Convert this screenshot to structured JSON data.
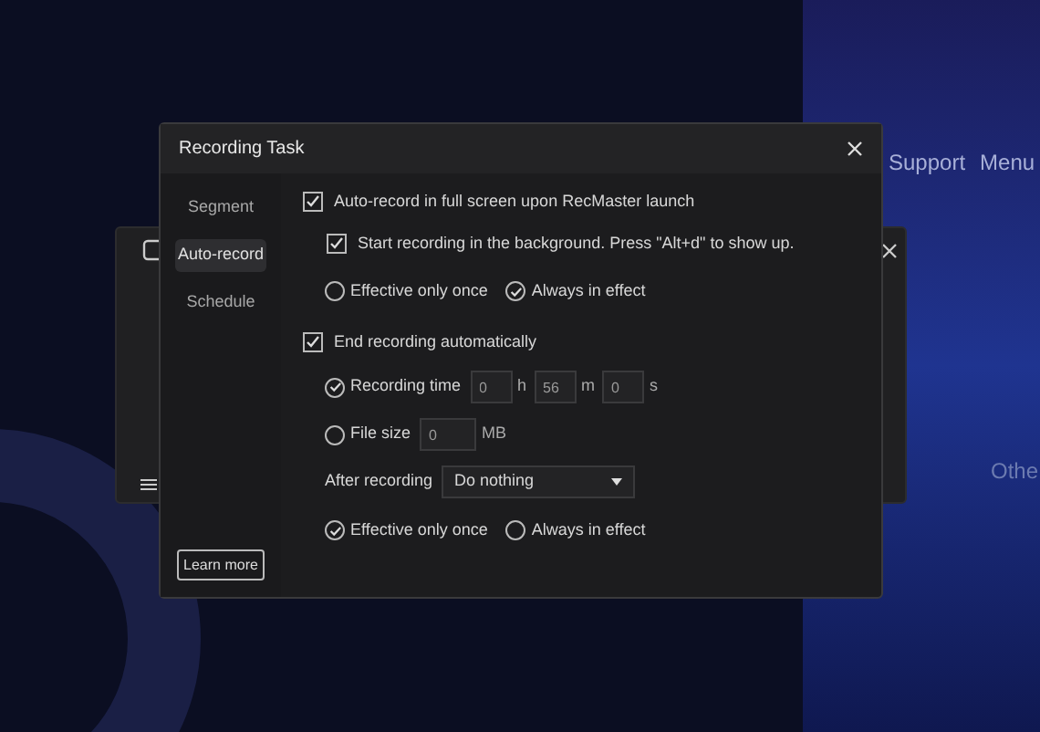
{
  "background": {
    "nav": [
      "Support",
      "Menu"
    ],
    "side_text": "Othe"
  },
  "dialog": {
    "title": "Recording Task",
    "tabs": [
      {
        "label": "Segment",
        "selected": false
      },
      {
        "label": "Auto-record",
        "selected": true
      },
      {
        "label": "Schedule",
        "selected": false
      }
    ],
    "learn_more": "Learn more",
    "auto_record": {
      "label": "Auto-record in full screen upon RecMaster launch",
      "checked": true,
      "background": {
        "label": "Start recording in the background. Press \"Alt+d\" to show up.",
        "checked": true
      },
      "modes": [
        {
          "label": "Effective only once",
          "selected": false
        },
        {
          "label": "Always in effect",
          "selected": true
        }
      ]
    },
    "end_recording": {
      "label": "End recording automatically",
      "checked": true,
      "conditions": [
        {
          "label": "Recording time",
          "selected": true,
          "fields": [
            {
              "value": "0",
              "unit": "h"
            },
            {
              "value": "56",
              "unit": "m"
            },
            {
              "value": "0",
              "unit": "s"
            }
          ]
        },
        {
          "label": "File size",
          "selected": false,
          "fields": [
            {
              "value": "0",
              "unit": "MB"
            }
          ]
        }
      ],
      "after": {
        "label": "After recording",
        "value": "Do nothing"
      },
      "modes": [
        {
          "label": "Effective only once",
          "selected": true
        },
        {
          "label": "Always in effect",
          "selected": false
        }
      ]
    }
  }
}
